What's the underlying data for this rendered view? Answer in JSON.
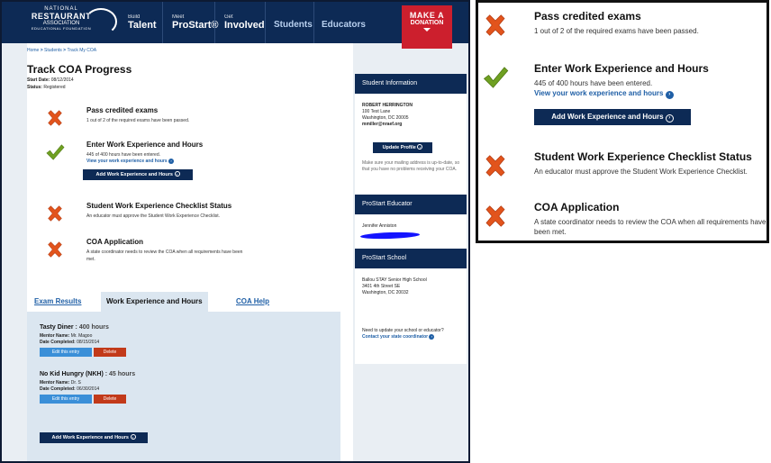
{
  "nav": {
    "logo": {
      "line1": "NATIONAL",
      "line2": "RESTAURANT",
      "line3": "ASSOCIATION",
      "line4": "EDUCATIONAL FOUNDATION"
    },
    "items": [
      {
        "small": "Build",
        "big": "Talent"
      },
      {
        "small": "Meet",
        "big": "ProStart®"
      },
      {
        "small": "Get",
        "big": "Involved"
      }
    ],
    "students": "Students",
    "educators": "Educators",
    "donate": {
      "line1": "MAKE A",
      "line2": "DONATION"
    }
  },
  "breadcrumb": {
    "home": "Home",
    "sep": " > ",
    "students": "Students",
    "current": "Track My COA"
  },
  "page": {
    "title": "Track COA Progress",
    "start_date_label": "Start Date:",
    "start_date": "08/12/2014",
    "status_label": "Status:",
    "status": "Registered"
  },
  "steps": [
    {
      "title": "Pass credited exams",
      "desc": "1 out of 2 of the required exams have been passed.",
      "state": "fail"
    },
    {
      "title": "Enter Work Experience and Hours",
      "desc": "445 of 400 hours have been entered.",
      "link": "View your work experience and hours",
      "button": "Add Work Experience and Hours",
      "state": "pass"
    },
    {
      "title": "Student Work Experience Checklist Status",
      "desc": "An educator must approve the Student Work Experience Checklist.",
      "state": "fail"
    },
    {
      "title": "COA Application",
      "desc": "A state coordinator needs to review the COA when all requirements have been met.",
      "state": "fail"
    }
  ],
  "tabs": [
    {
      "label": "Exam Results"
    },
    {
      "label": "Work Experience and Hours"
    },
    {
      "label": "COA Help"
    }
  ],
  "entries": [
    {
      "name": "Tasty Diner",
      "hours": " : 400 hours",
      "mentor_label": "Mentor Name:",
      "mentor": "Mr. Magoo",
      "date_label": "Date Completed:",
      "date": "08/15/2014",
      "edit": "Edit this entry",
      "delete": "Delete"
    },
    {
      "name": "No Kid Hungry (NKH)",
      "hours": " : 45 hours",
      "mentor_label": "Mentor Name:",
      "mentor": "Dr. S",
      "date_label": "Date Completed:",
      "date": "06/30/2014",
      "edit": "Edit this entry",
      "delete": "Delete"
    }
  ],
  "bottom_button": "Add Work Experience and Hours",
  "sidebar": {
    "student_info_head": "Student Information",
    "name": "ROBERT HERRINGTON",
    "addr1": "100 Test Lane",
    "addr2": "Washington, DC 20005",
    "email": "mmiller@nraef.org",
    "update_btn": "Update Profile",
    "note": "Make sure your mailing address is up-to-date, so that you have no problems receiving your COA.",
    "educator_head": "ProStart Educator",
    "educator": "Jennifer Anniston",
    "school_head": "ProStart School",
    "school1": "Ballou STAY Senior High School",
    "school2": "3401 4th Street SE",
    "school3": "Washington, DC 20032",
    "update_q": "Need to update your school or educator?",
    "contact": "Contact your state coordinator"
  },
  "colors": {
    "navy": "#0d2a55",
    "red": "#cc1f2d",
    "x_orange": "#e2541c",
    "check_green": "#6fa021",
    "link_blue": "#1f5fa6"
  }
}
